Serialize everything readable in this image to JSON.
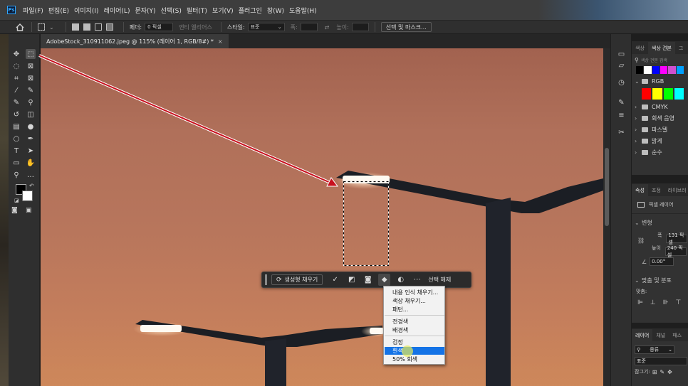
{
  "app": {
    "logo": "Ps",
    "menu": [
      "파일(F)",
      "편집(E)",
      "이미지(I)",
      "레이어(L)",
      "문자(Y)",
      "선택(S)",
      "필터(T)",
      "보기(V)",
      "플러그인",
      "창(W)",
      "도움말(H)"
    ]
  },
  "options_bar": {
    "feather_label": "페더:",
    "feather_value": "0 픽셀",
    "antialias_label": "앤티 앨리어스",
    "style_label": "스타일:",
    "style_value": "표준",
    "width_label": "폭:",
    "height_label": "높이:",
    "select_mask_button": "선택 및 마스크..."
  },
  "document": {
    "tab_title": "AdobeStock_310911062.jpeg @ 115% (레이어 1, RGB/8#) *"
  },
  "tools": [
    {
      "name": "move-tool",
      "glyph": "✥"
    },
    {
      "name": "marquee-tool",
      "glyph": "⬚"
    },
    {
      "name": "lasso-tool",
      "glyph": "◌"
    },
    {
      "name": "object-select-tool",
      "glyph": "⊠"
    },
    {
      "name": "crop-tool",
      "glyph": "⌗"
    },
    {
      "name": "frame-tool",
      "glyph": "⊠"
    },
    {
      "name": "eyedropper-tool",
      "glyph": "⁄"
    },
    {
      "name": "spot-healing-tool",
      "glyph": "✎"
    },
    {
      "name": "brush-tool",
      "glyph": "✎"
    },
    {
      "name": "clone-stamp-tool",
      "glyph": "⚲"
    },
    {
      "name": "history-brush-tool",
      "glyph": "↺"
    },
    {
      "name": "eraser-tool",
      "glyph": "◫"
    },
    {
      "name": "gradient-tool",
      "glyph": "▤"
    },
    {
      "name": "blur-tool",
      "glyph": "●"
    },
    {
      "name": "dodge-tool",
      "glyph": "○"
    },
    {
      "name": "pen-tool",
      "glyph": "✒"
    },
    {
      "name": "type-tool",
      "glyph": "T"
    },
    {
      "name": "path-select-tool",
      "glyph": "➤"
    },
    {
      "name": "rectangle-tool",
      "glyph": "▭"
    },
    {
      "name": "hand-tool",
      "glyph": "✋"
    },
    {
      "name": "zoom-tool",
      "glyph": "⚲"
    },
    {
      "name": "more-tools",
      "glyph": "…"
    }
  ],
  "foreground_color": "#000000",
  "background_color": "#ffffff",
  "swatches_panel": {
    "tabs": [
      "색상",
      "색상 견본",
      "그"
    ],
    "search_placeholder": "색상 견본 검색",
    "top_swatches": [
      "#000000",
      "#ffffff",
      "#0000ff",
      "#ff00ff",
      "#d050d0",
      "#00a0ff"
    ],
    "rgb_label": "RGB",
    "rgb_swatches": [
      "#ff0000",
      "#ffff00",
      "#00ff00",
      "#00ffff"
    ],
    "groups": [
      "CMYK",
      "회색 음영",
      "파스텔",
      "밝게",
      "순수"
    ]
  },
  "properties_panel": {
    "tabs": [
      "속성",
      "조정",
      "라이브러"
    ],
    "layer_type": "픽셀 레이어",
    "transform_label": "변형",
    "w_label": "폭",
    "w_value": "131 픽셀",
    "h_label": "높이",
    "h_value": "240 픽셀",
    "angle_value": "0.00°",
    "align_label": "맞춤 및 분포",
    "align_sub": "맞춤:"
  },
  "layers_panel": {
    "tabs": [
      "레이어",
      "채널",
      "패스"
    ],
    "filter_label": "종류",
    "blend_mode": "표준",
    "lock_label": "잠그기:"
  },
  "task_bar": {
    "generative_fill": "생성형 채우기",
    "deselect": "선택 해제"
  },
  "fill_menu": {
    "items": [
      "내용 인식 채우기...",
      "색상 채우기...",
      "패턴...",
      "전경색",
      "배경색",
      "검정",
      "흰색",
      "50% 회색"
    ],
    "selected": "흰색"
  }
}
